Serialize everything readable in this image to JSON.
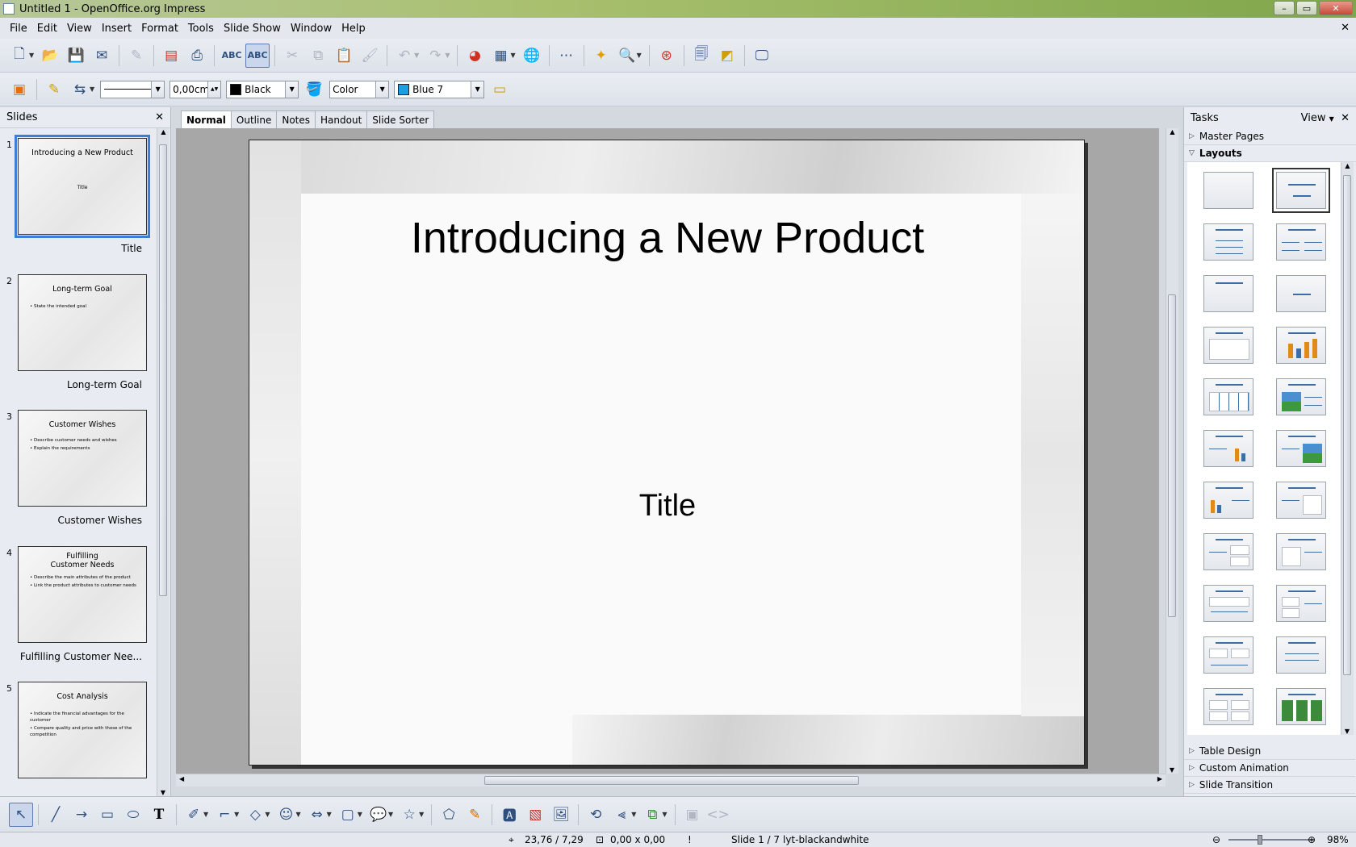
{
  "window": {
    "title": "Untitled 1 - OpenOffice.org Impress",
    "controls": [
      "–",
      "▭",
      "✕"
    ]
  },
  "menu": [
    "File",
    "Edit",
    "View",
    "Insert",
    "Format",
    "Tools",
    "Slide Show",
    "Window",
    "Help"
  ],
  "line_props": {
    "width_value": "0,00cm",
    "line_color": "Black",
    "fill_type": "Color",
    "fill_color": "Blue 7",
    "line_color_hex": "#000000",
    "fill_color_hex": "#1aa0e0"
  },
  "slides_panel": {
    "title": "Slides",
    "close": "✕",
    "slides": [
      {
        "num": "1",
        "title": "Introducing a New Product",
        "body": [
          "Title"
        ],
        "label": "Title",
        "selected": true
      },
      {
        "num": "2",
        "title": "Long-term Goal",
        "body": [
          "• State the intended goal"
        ],
        "label": "Long-term Goal"
      },
      {
        "num": "3",
        "title": "Customer Wishes",
        "body": [
          "• Describe customer needs and wishes",
          "• Explain the requirements"
        ],
        "label": "Customer Wishes"
      },
      {
        "num": "4",
        "title": "Fulfilling\nCustomer Needs",
        "body": [
          "• Describe the main attributes of the product",
          "• Link the product attributes to customer needs"
        ],
        "label": "Fulfilling Customer Nee..."
      },
      {
        "num": "5",
        "title": "Cost Analysis",
        "body": [
          "• Indicate the financial advantages for the customer",
          "• Compare quality and price with those of the competition"
        ],
        "label": ""
      }
    ]
  },
  "view_tabs": [
    "Normal",
    "Outline",
    "Notes",
    "Handout",
    "Slide Sorter"
  ],
  "current_slide": {
    "title": "Introducing a New Product",
    "subtitle": "Title"
  },
  "tasks_panel": {
    "title": "Tasks",
    "view_label": "View",
    "close": "✕",
    "sections_top": [
      {
        "label": "Master Pages",
        "expanded": false
      },
      {
        "label": "Layouts",
        "expanded": true
      }
    ],
    "sections_bottom": [
      "Table Design",
      "Custom Animation",
      "Slide Transition"
    ]
  },
  "status": {
    "position": "23,76 / 7,29",
    "size": "0,00 x 0,00",
    "slide": "Slide 1 / 7",
    "master": "lyt-blackandwhite",
    "zoom": "98%"
  }
}
